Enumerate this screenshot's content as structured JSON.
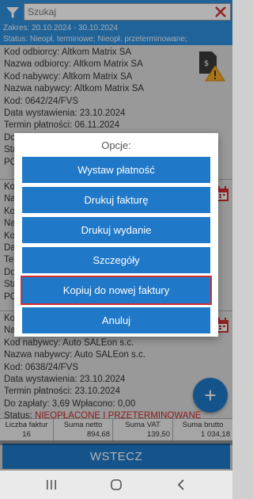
{
  "header": {
    "search_placeholder": "Szukaj",
    "range_text": "Zakres: 20.10.2024 - 30.10.2024",
    "status_text": "Status:  Nieopł. terminowe; Nieopł. przeterminowane;"
  },
  "cards": [
    {
      "rows": [
        {
          "label": "Kod odbiorcy:",
          "value": "Altkom Matrix SA"
        },
        {
          "label": "Nazwa odbiorcy:",
          "value": "Altkom Matrix SA"
        },
        {
          "label": "Kod nabywcy:",
          "value": "Altkom Matrix SA"
        },
        {
          "label": "Nazwa nabywcy:",
          "value": "Altkom Matrix SA"
        },
        {
          "label": "Kod:",
          "value": "0642/24/FVS"
        },
        {
          "label": "Data wystawienia:",
          "value": "23.10.2024"
        },
        {
          "label": "Termin płatności:",
          "value": "06.11.2024"
        },
        {
          "label": "Do",
          "value": ""
        },
        {
          "label": "Sta",
          "value": ""
        },
        {
          "label": "PO",
          "value": ""
        }
      ]
    },
    {
      "rows": [
        {
          "label": "Ko",
          "value": ""
        },
        {
          "label": "Na",
          "value": ""
        },
        {
          "label": "Ko",
          "value": ""
        },
        {
          "label": "Na",
          "value": ""
        },
        {
          "label": "Ko",
          "value": ""
        },
        {
          "label": "Da",
          "value": ""
        },
        {
          "label": "Te",
          "value": ""
        },
        {
          "label": "Do",
          "value": ""
        },
        {
          "label": "Sta",
          "value": ""
        },
        {
          "label": "PO",
          "value": ""
        }
      ]
    },
    {
      "rows": [
        {
          "label": "Ko",
          "value": ""
        },
        {
          "label": "Na",
          "value": ""
        },
        {
          "label": "Kod nabywcy:",
          "value": "Auto SALEon s.c."
        },
        {
          "label": "Nazwa nabywcy:",
          "value": "Auto SALEon s.c."
        },
        {
          "label": "Kod:",
          "value": "0638/24/FVS"
        },
        {
          "label": "Data wystawienia:",
          "value": "23.10.2024"
        },
        {
          "label": "Termin płatności:",
          "value": "23.10.2024"
        },
        {
          "label": "Do zapłaty:",
          "value": "3,69   Wpłacono:  0,00"
        },
        {
          "label": "Status:",
          "value": "NIEOPŁACONE I PRZETERMINOWANE"
        }
      ]
    }
  ],
  "summary": {
    "headers": [
      "Liczba faktur",
      "Suma netto",
      "Suma VAT",
      "Suma brutto"
    ],
    "values": [
      "16",
      "894,68",
      "139,50",
      "1 034,18"
    ]
  },
  "dialog": {
    "title": "Opcje:",
    "options": [
      "Wystaw płatność",
      "Drukuj fakturę",
      "Drukuj wydanie",
      "Szczegóły",
      "Kopiuj do nowej faktury",
      "Anuluj"
    ]
  },
  "fab_label": "+",
  "back_label": "WSTECZ",
  "colors": {
    "header_bg": "#2f8fdc",
    "button_bg": "#1f78c8",
    "selected_outline": "#d32f2f",
    "status_red": "#c62828"
  }
}
